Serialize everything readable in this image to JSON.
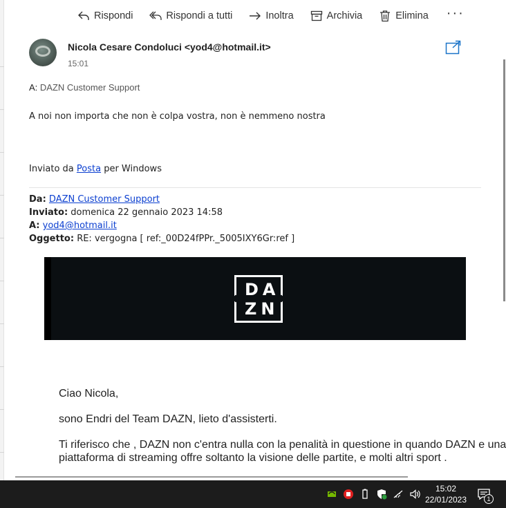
{
  "toolbar": {
    "reply": "Rispondi",
    "reply_all": "Rispondi a tutti",
    "forward": "Inoltra",
    "archive": "Archivia",
    "delete": "Elimina",
    "more": "···"
  },
  "message": {
    "sender_name": "Nicola Cesare Condoluci",
    "sender_email": "<yod4@hotmail.it>",
    "time": "15:01",
    "to_label": "A:",
    "to_value": "DAZN Customer Support",
    "body_line": "A noi non importa che non è colpa vostra, non è nemmeno nostra",
    "signature_prefix": "Inviato da",
    "signature_link": "Posta",
    "signature_suffix": "per Windows"
  },
  "quoted_header": {
    "from_label": "Da:",
    "from_value": "DAZN Customer Support",
    "sent_label": "Inviato:",
    "sent_value": "domenica 22 gennaio 2023 14:58",
    "to_label": "A:",
    "to_value": "yod4@hotmail.it",
    "subject_label": "Oggetto:",
    "subject_value": "RE: vergogna [ ref:_00D24fPPr._5005IXY6Gr:ref ]"
  },
  "banner": {
    "logo_line1": "DA",
    "logo_line2": "ZN",
    "bg_color": "#0b0f12"
  },
  "reply": {
    "greeting": "Ciao Nicola,",
    "intro": "sono Endri del Team DAZN, lieto d'assisterti.",
    "para_line1": "Ti riferisco che , DAZN non c'entra nulla con la penalità in questione in quando DAZN e una",
    "para_line2": "piattaforma di streaming offre soltanto la visione delle partite, e molti altri sport ."
  },
  "taskbar": {
    "time": "15:02",
    "date": "22/01/2023",
    "notification_count": "1"
  },
  "colors": {
    "link": "#0b3fd0",
    "taskbar": "#1c1c1c",
    "accent": "#1a73c8"
  }
}
